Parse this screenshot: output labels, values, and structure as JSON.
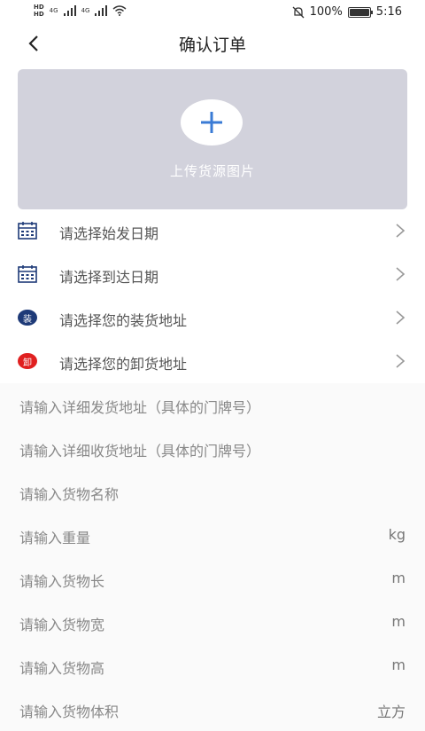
{
  "status": {
    "hd1": "HD",
    "hd2": "HD",
    "net1": "4G",
    "net2": "4G",
    "battery_pct": "100%",
    "battery_level": 1.0,
    "time": "5:16"
  },
  "header": {
    "title": "确认订单"
  },
  "upload": {
    "label": "上传货源图片"
  },
  "selectors": [
    {
      "label": "请选择始发日期",
      "icon": "calendar-icon"
    },
    {
      "label": "请选择到达日期",
      "icon": "calendar-icon"
    },
    {
      "label": "请选择您的装货地址",
      "icon": "load-badge-icon",
      "badge_text": "装",
      "badge_color": "#1e3a78"
    },
    {
      "label": "请选择您的卸货地址",
      "icon": "unload-badge-icon",
      "badge_text": "卸",
      "badge_color": "#e02020"
    }
  ],
  "inputs": [
    {
      "placeholder": "请输入详细发货地址（具体的门牌号）",
      "unit": ""
    },
    {
      "placeholder": "请输入详细收货地址（具体的门牌号）",
      "unit": ""
    },
    {
      "placeholder": "请输入货物名称",
      "unit": ""
    },
    {
      "placeholder": "请输入重量",
      "unit": "kg"
    },
    {
      "placeholder": "请输入货物长",
      "unit": "m"
    },
    {
      "placeholder": "请输入货物宽",
      "unit": "m"
    },
    {
      "placeholder": "请输入货物高",
      "unit": "m"
    },
    {
      "placeholder": "请输入货物体积",
      "unit": "立方"
    }
  ],
  "colors": {
    "upload_bg": "#d2d2dc",
    "plus": "#3a7bd5",
    "calendar": "#1e3a78"
  }
}
